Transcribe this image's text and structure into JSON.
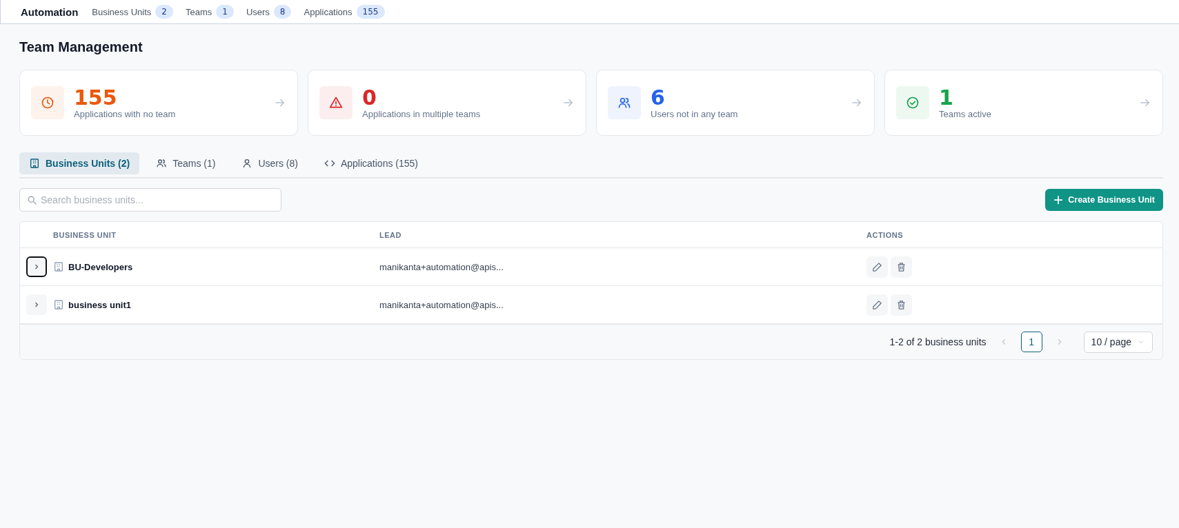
{
  "top_bar": {
    "title": "Automation",
    "counters": [
      {
        "label": "Business Units",
        "count": "2"
      },
      {
        "label": "Teams",
        "count": "1"
      },
      {
        "label": "Users",
        "count": "8"
      },
      {
        "label": "Applications",
        "count": "155"
      }
    ]
  },
  "page_title": "Team Management",
  "stats": [
    {
      "kind": "clock",
      "value": "155",
      "label": "Applications with no team",
      "color": "#ea580c"
    },
    {
      "kind": "warning",
      "value": "0",
      "label": "Applications in multiple teams",
      "color": "#dc2626"
    },
    {
      "kind": "users",
      "value": "6",
      "label": "Users not in any team",
      "color": "#2563eb"
    },
    {
      "kind": "check",
      "value": "1",
      "label": "Teams active",
      "color": "#16a34a"
    }
  ],
  "tabs": [
    {
      "kind": "building",
      "label": "Business Units (2)",
      "selected": true
    },
    {
      "kind": "users",
      "label": "Teams (1)",
      "selected": false
    },
    {
      "kind": "user",
      "label": "Users (8)",
      "selected": false
    },
    {
      "kind": "code",
      "label": "Applications (155)",
      "selected": false
    }
  ],
  "search": {
    "placeholder": "Search business units..."
  },
  "create_button": "Create Business Unit",
  "table": {
    "columns": [
      "BUSINESS UNIT",
      "LEAD",
      "ACTIONS"
    ],
    "rows": [
      {
        "name": "BU-Developers",
        "lead": "manikanta+automation@apis...",
        "focused": true
      },
      {
        "name": "business unit1",
        "lead": "manikanta+automation@apis...",
        "focused": false
      }
    ]
  },
  "pagination": {
    "summary": "1-2 of 2 business units",
    "pages": [
      {
        "label": "1",
        "selected": true
      }
    ],
    "page_size": "10 / page"
  }
}
